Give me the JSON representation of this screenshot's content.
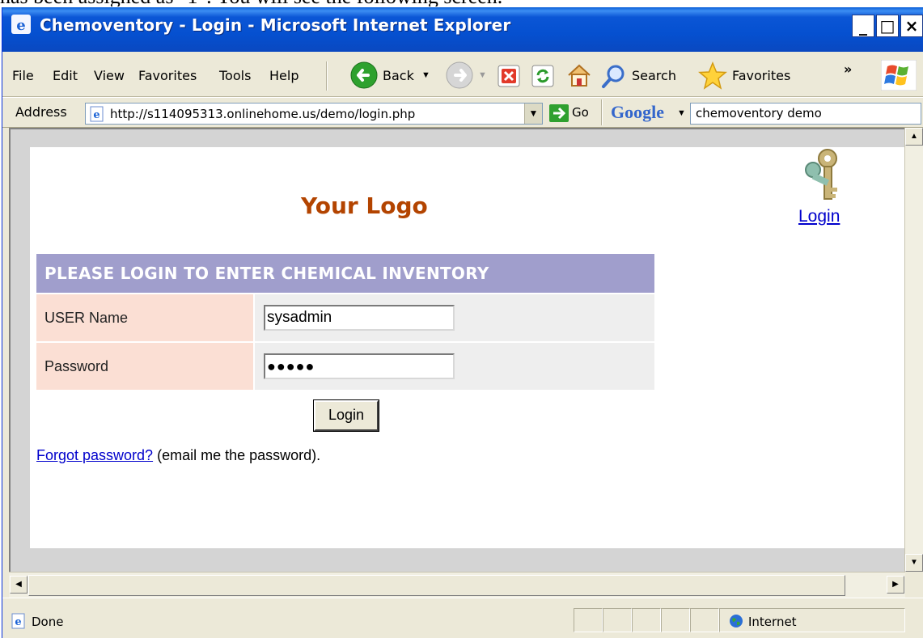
{
  "doc_caption": "has been assigned as \"1\". You will see the following screen.",
  "window": {
    "title": "Chemoventory - Login - Microsoft Internet Explorer",
    "controls": [
      "_",
      "□",
      "×"
    ]
  },
  "menu": {
    "items": [
      "File",
      "Edit",
      "View",
      "Favorites",
      "Tools",
      "Help"
    ]
  },
  "toolbar": {
    "back_label": "Back",
    "search_label": "Search",
    "favorites_label": "Favorites",
    "chevron": "»"
  },
  "address": {
    "label": "Address",
    "url": "http://s114095313.onlinehome.us/demo/login.php",
    "go_label": "Go",
    "google_label": "Google",
    "google_query": "chemoventory demo"
  },
  "page": {
    "logo_text": "Your Logo",
    "login_link": "Login",
    "form_header": "PLEASE LOGIN TO ENTER CHEMICAL INVENTORY",
    "user_label": "USER Name",
    "user_value": "sysadmin",
    "password_label": "Password",
    "password_mask": "●●●●●",
    "login_button": "Login",
    "forgot_link": "Forgot password?",
    "forgot_suffix": " (email me the password)."
  },
  "status": {
    "text": "Done",
    "zone": "Internet"
  },
  "colors": {
    "titlebar": "#0550d0",
    "form_header": "#a09ecc",
    "label_cell": "#fbdfd4",
    "logo": "#b34400",
    "link": "#0000cc"
  }
}
